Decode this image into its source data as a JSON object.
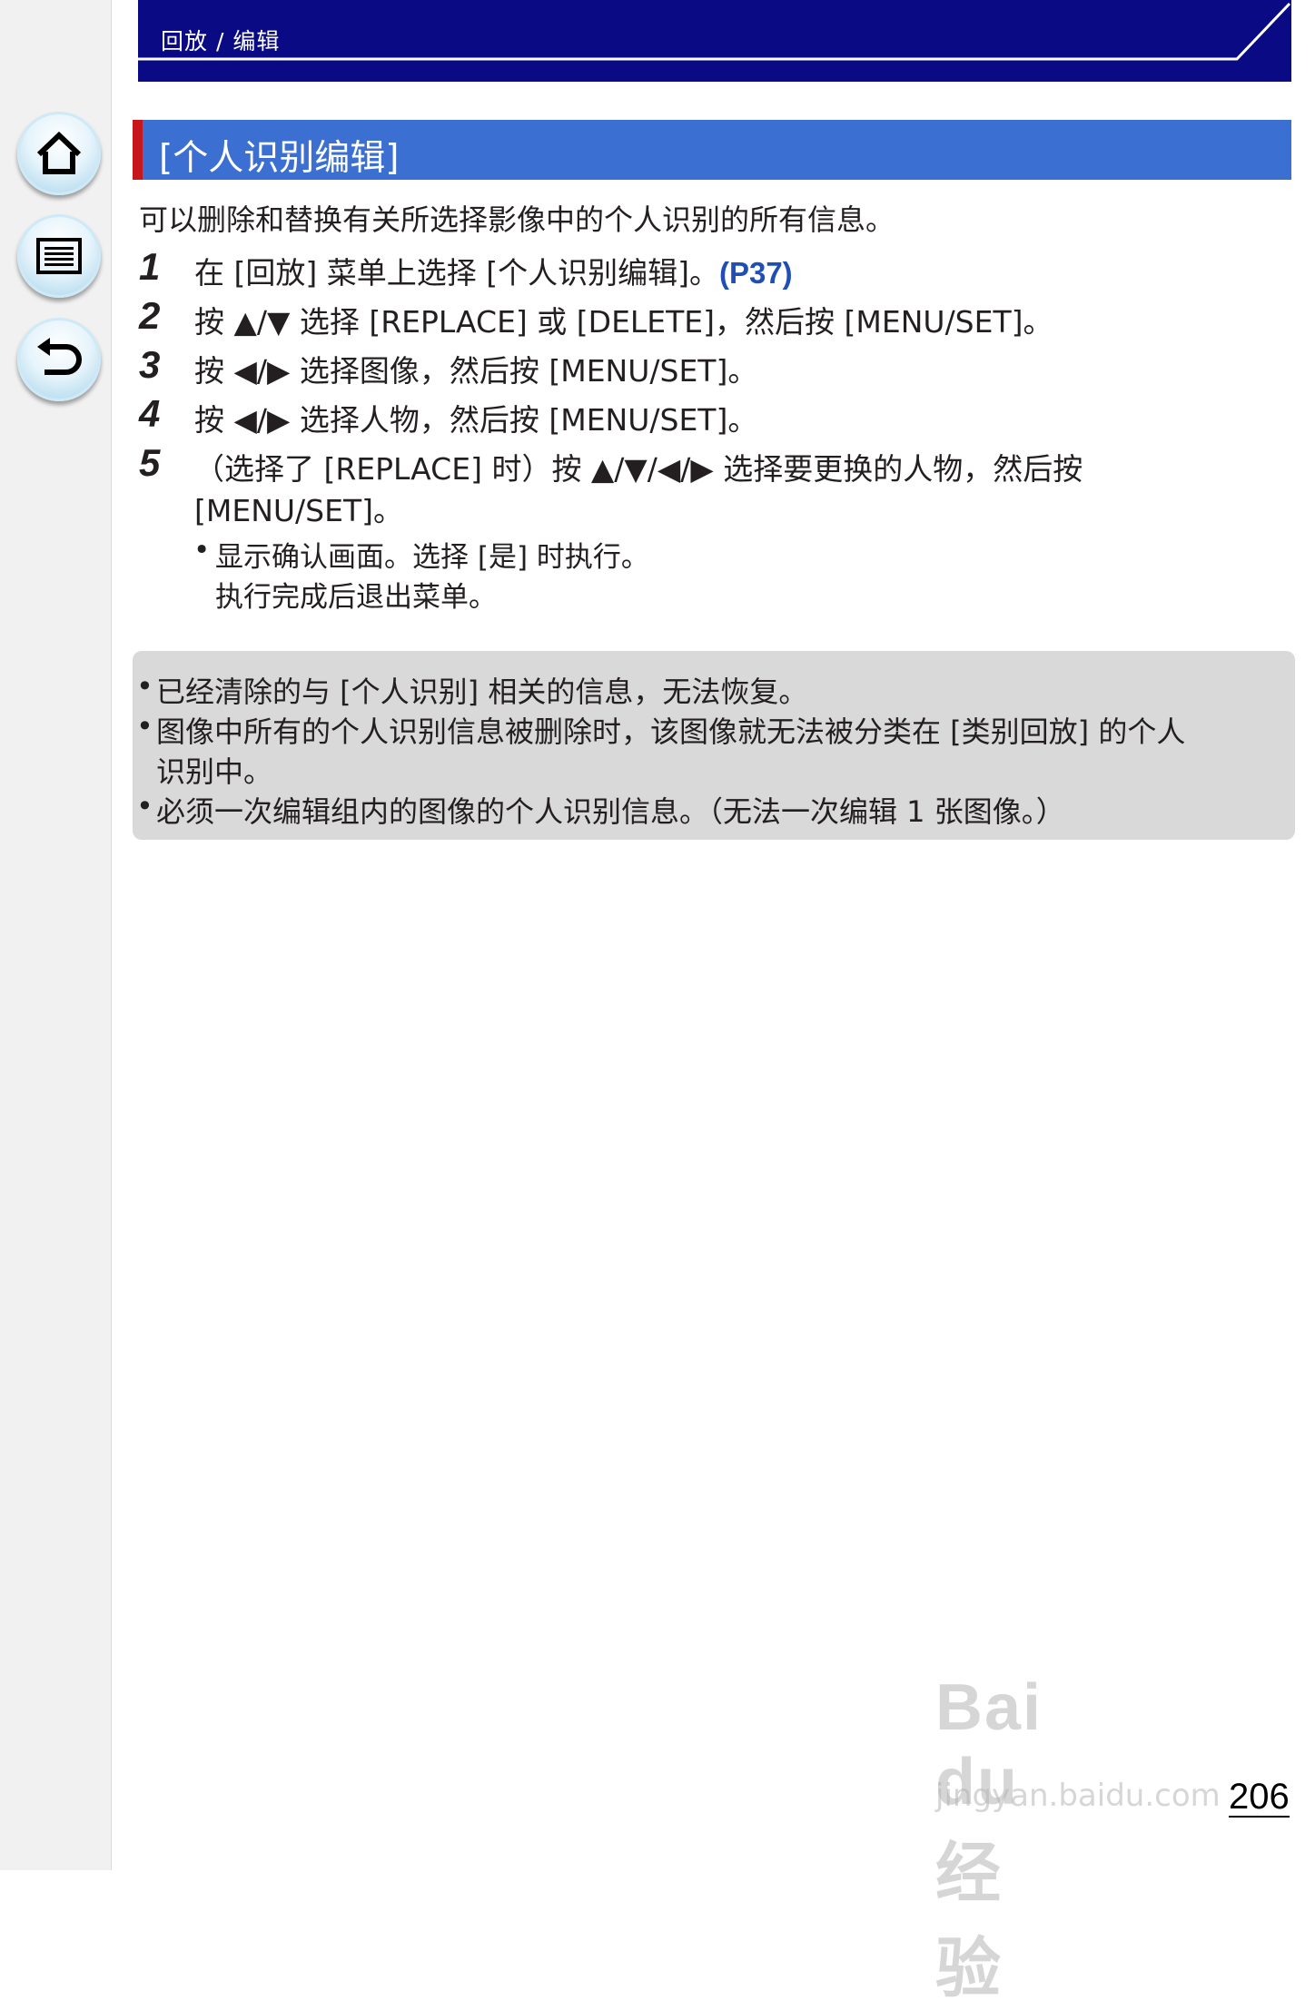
{
  "header": {
    "breadcrumb": "回放 / 编辑"
  },
  "nav": {
    "home_icon": "home-icon",
    "menu_icon": "list-menu-icon",
    "back_icon": "return-arrow-icon"
  },
  "section": {
    "title": "[个人识别编辑]"
  },
  "intro": "可以删除和替换有关所选择影像中的个人识别的所有信息。",
  "steps": [
    {
      "num": "1",
      "text": "在 [回放] 菜单上选择 [个人识别编辑]。",
      "link": "(P37)"
    },
    {
      "num": "2",
      "text": "按 ▲/▼ 选择 [REPLACE] 或 [DELETE]，然后按 [MENU/SET]。"
    },
    {
      "num": "3",
      "text": "按 ◀/▶ 选择图像，然后按 [MENU/SET]。"
    },
    {
      "num": "4",
      "text": "按 ◀/▶ 选择人物，然后按 [MENU/SET]。"
    },
    {
      "num": "5",
      "text_line1": "（选择了 [REPLACE] 时）按 ▲/▼/◀/▶ 选择要更换的人物，然后按",
      "text_line2": "[MENU/SET]。",
      "sub_bullet": "•",
      "sub_line1": "显示确认画面。选择 [是] 时执行。",
      "sub_line2": "执行完成后退出菜单。"
    }
  ],
  "notes": {
    "bullet": "•",
    "line1": "已经清除的与 [个人识别] 相关的信息，无法恢复。",
    "line2a": "图像中所有的个人识别信息被删除时，该图像就无法被分类在 [类别回放] 的个人",
    "line2b": "识别中。",
    "line3": "必须一次编辑组内的图像的个人识别信息。（无法一次编辑 1 张图像。）"
  },
  "watermark": {
    "logo": "Bai du 经验",
    "url": "jingyan.baidu.com"
  },
  "page_number": "206",
  "colors": {
    "header_navy": "#0a0a85",
    "section_blue": "#3b6fd1",
    "section_red": "#c8161d",
    "link_blue": "#1f4fb4",
    "note_gray": "#d9d9d9"
  }
}
